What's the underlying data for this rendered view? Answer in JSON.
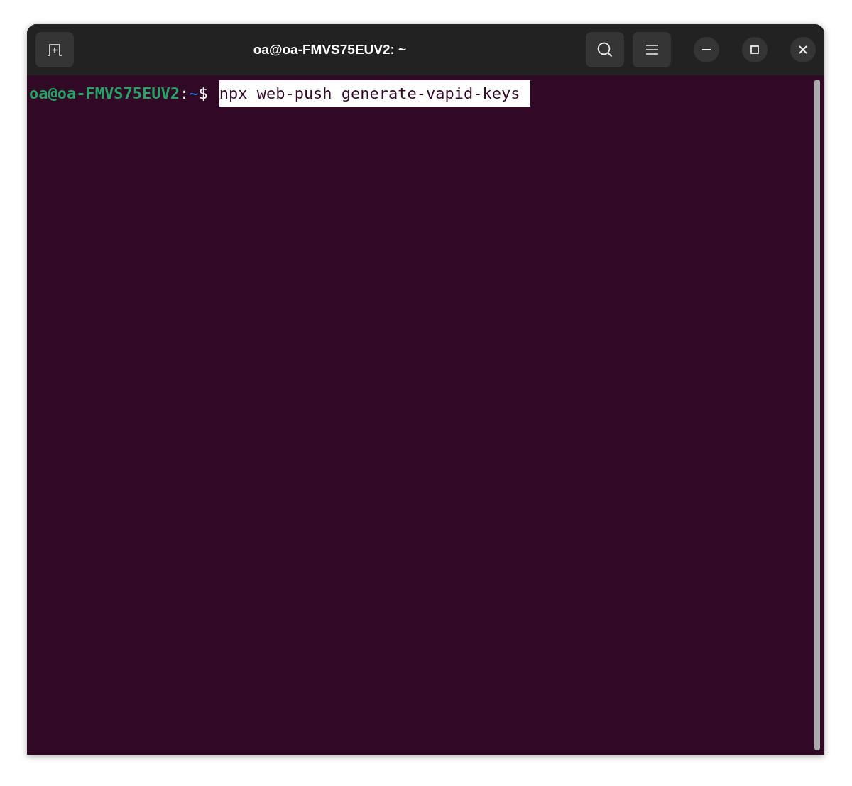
{
  "window": {
    "title": "oa@oa-FMVS75EUV2: ~"
  },
  "terminal": {
    "lines": [
      {
        "user_host": "oa@oa-FMVS75EUV2",
        "separator": ":",
        "path": "~",
        "symbol": "$",
        "command": "npx web-push generate-vapid-keys",
        "selected": true
      }
    ]
  }
}
